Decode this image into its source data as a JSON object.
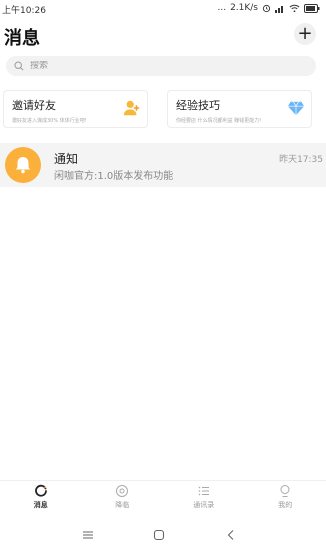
{
  "status_bar": {
    "time": "上午10:26",
    "dots": "...",
    "speed": "2.1K/s"
  },
  "header": {
    "title": "消息",
    "add_label": "+"
  },
  "search": {
    "placeholder": "搜索"
  },
  "cards": [
    {
      "title": "邀请好友",
      "desc": "邀好友进入谋成30% 体体行业吧!",
      "icon": "person-add-icon"
    },
    {
      "title": "经验技巧",
      "desc": "你经要店 什么情况都利益 赚钱更能力!",
      "icon": "diamond-icon"
    }
  ],
  "messages": [
    {
      "title": "通知",
      "subtitle": "闲咖官方:1.0版本发布功能",
      "time": "昨天17:35",
      "icon": "bell-icon"
    }
  ],
  "tabs": [
    {
      "label": "消息",
      "icon": "message-icon",
      "active": true
    },
    {
      "label": "降临",
      "icon": "eye-icon",
      "active": false
    },
    {
      "label": "通讯录",
      "icon": "contacts-icon",
      "active": false
    },
    {
      "label": "我的",
      "icon": "profile-icon",
      "active": false
    }
  ],
  "colors": {
    "accent": "#fbb03b",
    "card_icon_blue": "#5aa9f5",
    "row_bg": "#f4f4f4"
  }
}
